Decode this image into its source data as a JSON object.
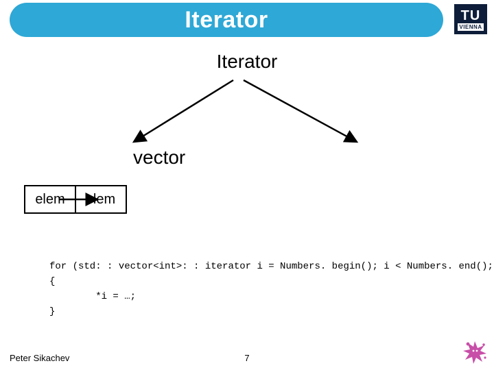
{
  "title": "Iterator",
  "subtitle": "Iterator",
  "logo": {
    "top": "TU",
    "bottom": "VIENNA"
  },
  "diagram": {
    "vector_label": "vector",
    "cells": [
      "elem",
      "elem"
    ]
  },
  "code": {
    "line1": "for (std: : vector<int>: : iterator i = Numbers. begin(); i < Numbers. end(); i++)",
    "line2": "{",
    "line3": "        *i = …;",
    "line4": "}"
  },
  "footer": {
    "author": "Peter Sikachev",
    "page": "7"
  }
}
